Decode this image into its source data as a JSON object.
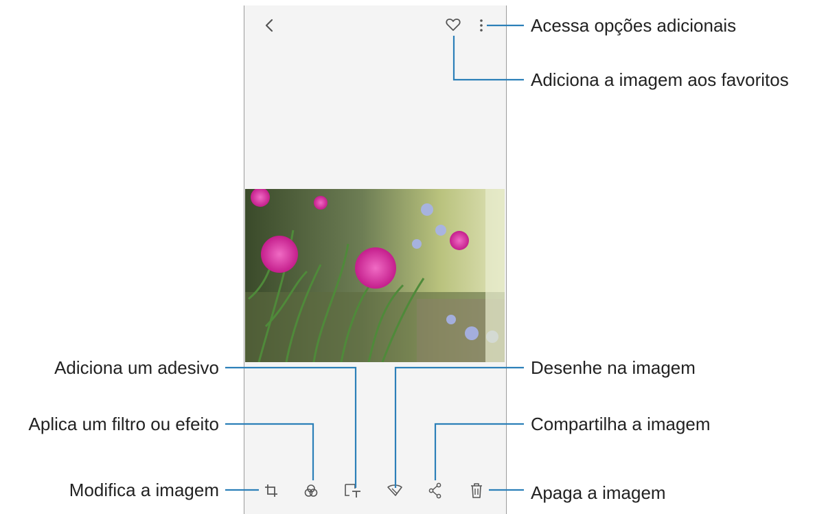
{
  "callouts": {
    "more_options": "Acessa opções adicionais",
    "favorite": "Adiciona a imagem aos favoritos",
    "sticker": "Adiciona um adesivo",
    "draw": "Desenhe na imagem",
    "filter": "Aplica um filtro ou efeito",
    "share": "Compartilha a imagem",
    "edit": "Modifica a imagem",
    "delete": "Apaga a imagem"
  },
  "icons": {
    "back": "back-arrow-icon",
    "favorite": "heart-icon",
    "more": "more-options-icon",
    "edit": "crop-rotate-icon",
    "filter": "filter-icon",
    "sticker": "sticker-icon",
    "draw": "draw-brush-icon",
    "share": "share-icon",
    "delete": "trash-icon"
  },
  "colors": {
    "callout_line": "#2b7fb8",
    "background": "#f4f4f4",
    "icon": "#555555"
  }
}
